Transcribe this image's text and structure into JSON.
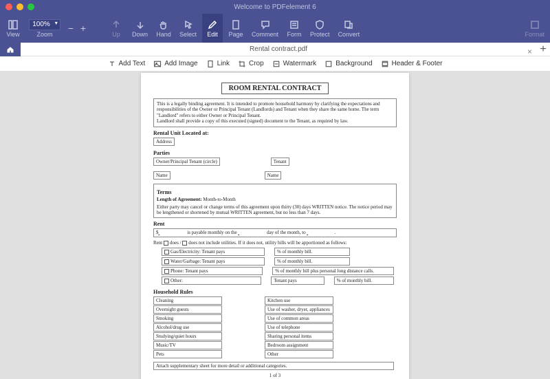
{
  "window": {
    "title": "Welcome to PDFelement 6"
  },
  "ribbon": {
    "view": "View",
    "zoom": "Zoom",
    "zoom_value": "100%",
    "up": "Up",
    "down": "Down",
    "hand": "Hand",
    "select": "Select",
    "edit": "Edit",
    "page": "Page",
    "comment": "Comment",
    "form": "Form",
    "protect": "Protect",
    "convert": "Convert",
    "format": "Format"
  },
  "tab": {
    "name": "Rental contract.pdf"
  },
  "subtoolbar": {
    "add_text": "Add Text",
    "add_image": "Add Image",
    "link": "Link",
    "crop": "Crop",
    "watermark": "Watermark",
    "background": "Background",
    "header_footer": "Header & Footer"
  },
  "doc": {
    "title": "ROOM RENTAL CONTRACT",
    "intro": "This is a legally binding agreement.  It is intended to promote household harmony by clarifying the expectations and responsibilities of the Owner or Principal Tenant (Landlords) and Tenant when they share the same home.  The term \"Landlord\" refers to either Owner or Principal Tenant.\nLandlord shall provide a copy of this executed (signed) document to the Tenant, as required by law.",
    "located": "Rental Unit Located at:",
    "address": "Address",
    "parties": "Parties",
    "owner": "Owner/Principal Tenant (circle)",
    "tenant": "Tenant",
    "name": "Name",
    "terms": "Terms",
    "length_label": "Length of Agreement:",
    "length_value": "Month-to-Month",
    "notice": "Either party may cancel or change terms of this agreement upon thirty (30) days WRITTEN notice.  The notice period may be lengthened or shortened by mutual WRITTEN agreement, but no less than 7 days.",
    "rent": "Rent",
    "rent_line": "is payable monthly on the",
    "rent_line2": "day of the month, to",
    "util_intro_a": "does",
    "util_intro_b": "does not include utilities.  If it does not, utility bills will be apportioned as follows:",
    "gas": "Gas/Electricity: Tenant pays",
    "water": "Water/Garbage: Tenant pays",
    "phone": "Phone: Tenant pays",
    "other": "Other:",
    "monthly": "% of monthly bill.",
    "monthly_phone": "% of monthly bill plus personal long distance calls.",
    "tenant_pays": "Tenant pays",
    "household": "Household Rules",
    "col1": [
      "Cleaning",
      "Overnight guests",
      "Smoking",
      "Alcohol/drug use",
      "Studying/quiet hours",
      "Music/TV",
      "Pets"
    ],
    "col2": [
      "Kitchen use",
      "Use of washer, dryer, appliances",
      "Use of common areas",
      "Use of telephone",
      "Sharing personal items",
      "Bedroom assignment",
      "Other"
    ],
    "attach": "Attach supplementary sheet for more detail or additional categories.",
    "pgnum": "1 of 3"
  }
}
